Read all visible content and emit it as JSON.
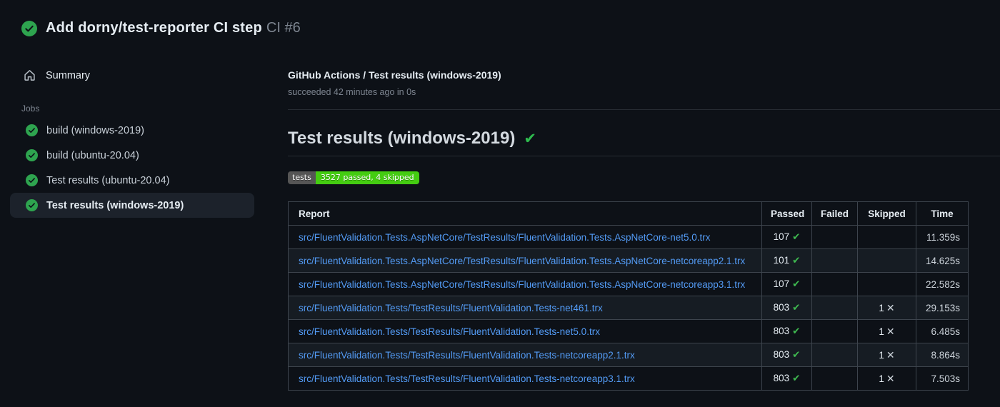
{
  "header": {
    "title": "Add dorny/test-reporter CI step",
    "run_number": "CI #6",
    "status": "success"
  },
  "sidebar": {
    "summary_label": "Summary",
    "jobs_label": "Jobs",
    "jobs": [
      {
        "label": "build (windows-2019)",
        "status": "success",
        "selected": false
      },
      {
        "label": "build (ubuntu-20.04)",
        "status": "success",
        "selected": false
      },
      {
        "label": "Test results (ubuntu-20.04)",
        "status": "success",
        "selected": false
      },
      {
        "label": "Test results (windows-2019)",
        "status": "success",
        "selected": true
      }
    ]
  },
  "main": {
    "check_title": "GitHub Actions / Test results (windows-2019)",
    "check_status": "succeeded 42 minutes ago in 0s",
    "section_title": "Test results (windows-2019)",
    "section_status_icon": "✔",
    "badge": {
      "label": "tests",
      "value": "3527 passed, 4 skipped",
      "label_bg": "#555555",
      "value_bg": "#44cc11"
    },
    "table": {
      "headers": [
        "Report",
        "Passed",
        "Failed",
        "Skipped",
        "Time"
      ],
      "pass_icon": "✔",
      "skip_icon": "✕",
      "rows": [
        {
          "report": "src/FluentValidation.Tests.AspNetCore/TestResults/FluentValidation.Tests.AspNetCore-net5.0.trx",
          "passed": "107",
          "failed": "",
          "skipped": "",
          "time": "11.359s"
        },
        {
          "report": "src/FluentValidation.Tests.AspNetCore/TestResults/FluentValidation.Tests.AspNetCore-netcoreapp2.1.trx",
          "passed": "101",
          "failed": "",
          "skipped": "",
          "time": "14.625s"
        },
        {
          "report": "src/FluentValidation.Tests.AspNetCore/TestResults/FluentValidation.Tests.AspNetCore-netcoreapp3.1.trx",
          "passed": "107",
          "failed": "",
          "skipped": "",
          "time": "22.582s"
        },
        {
          "report": "src/FluentValidation.Tests/TestResults/FluentValidation.Tests-net461.trx",
          "passed": "803",
          "failed": "",
          "skipped": "1",
          "time": "29.153s"
        },
        {
          "report": "src/FluentValidation.Tests/TestResults/FluentValidation.Tests-net5.0.trx",
          "passed": "803",
          "failed": "",
          "skipped": "1",
          "time": "6.485s"
        },
        {
          "report": "src/FluentValidation.Tests/TestResults/FluentValidation.Tests-netcoreapp2.1.trx",
          "passed": "803",
          "failed": "",
          "skipped": "1",
          "time": "8.864s"
        },
        {
          "report": "src/FluentValidation.Tests/TestResults/FluentValidation.Tests-netcoreapp3.1.trx",
          "passed": "803",
          "failed": "",
          "skipped": "1",
          "time": "7.503s"
        }
      ]
    }
  },
  "colors": {
    "background": "#0d1117",
    "success_green": "#2ea44f",
    "check_green": "#3fb950",
    "link_blue": "#539bf5",
    "table_border": "#3d444d",
    "selected_item_bg": "#1c222b"
  }
}
